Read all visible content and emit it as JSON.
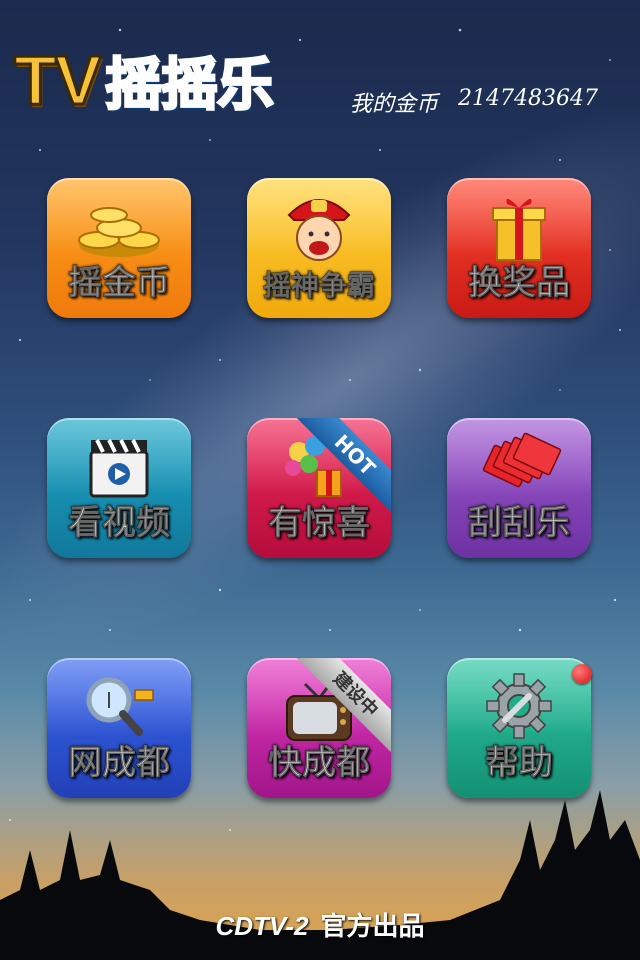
{
  "header": {
    "logo_tv": "TV",
    "logo_name": "摇摇乐",
    "coins_label": "我的金币",
    "coins_value": "2147483647"
  },
  "tiles": [
    {
      "label": "摇金币",
      "color": "#f58a14",
      "icon": "gold-coins-icon"
    },
    {
      "label": "摇神争霸",
      "color": "#f5b81c",
      "icon": "god-of-wealth-icon"
    },
    {
      "label": "换奖品",
      "color": "#e0261c",
      "icon": "gift-box-icon"
    },
    {
      "label": "看视频",
      "color": "#1690b4",
      "icon": "clapperboard-icon"
    },
    {
      "label": "有惊喜",
      "color": "#d61b4b",
      "icon": "balloons-gift-icon",
      "badge": "HOT"
    },
    {
      "label": "刮刮乐",
      "color": "#8646ba",
      "icon": "scratch-cards-icon"
    },
    {
      "label": "网成都",
      "color": "#2f54d4",
      "icon": "magnifier-icon"
    },
    {
      "label": "快成都",
      "color": "#c42aa8",
      "icon": "tv-icon",
      "badge": "建设中"
    },
    {
      "label": "帮助",
      "color": "#1fae8b",
      "icon": "gear-wrench-icon"
    }
  ],
  "footer": {
    "brand": "CDTV-2",
    "text": "官方出品"
  }
}
